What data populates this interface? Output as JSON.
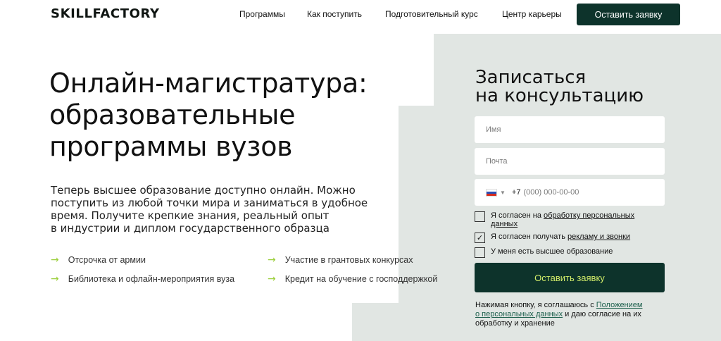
{
  "header": {
    "logo": "SKILLFACTORY",
    "nav": [
      "Программы",
      "Как поступить",
      "Подготовительный курс",
      "Центр карьеры"
    ],
    "cta": "Оставить заявку"
  },
  "hero": {
    "title_lines": [
      "Онлайн‑магистратура:",
      "образовательные",
      "программы вузов"
    ],
    "description_lines": [
      "Теперь высшее образование доступно онлайн. Можно",
      "поступить из любой точки мира и заниматься в удобное",
      "время. Получите крепкие знания, реальный опыт",
      "в индустрии и диплом государственного образца"
    ],
    "features": [
      "Отсрочка от армии",
      "Участие в грантовых конкурсах",
      "Библиотека и офлайн-мероприятия вуза",
      "Кредит на обучение с господдержкой"
    ]
  },
  "form": {
    "title_lines": [
      "Записаться",
      "на консультацию"
    ],
    "name_placeholder": "Имя",
    "email_placeholder": "Почта",
    "phone_code": "+7",
    "phone_placeholder": "(000) 000-00-00",
    "consent_personal": {
      "prefix": "Я согласен на ",
      "link": "обработку персональных",
      "link2": "данных",
      "checked": false
    },
    "consent_ads": {
      "prefix": "Я согласен получать ",
      "link": "рекламу и звонки",
      "checked": true
    },
    "higher_education": {
      "label": "У меня есть высшее образование",
      "checked": false
    },
    "submit": "Оставить заявку",
    "disclaimer": {
      "prefix": "Нажимая кнопку, я соглашаюсь с ",
      "link1": "Положением",
      "link2": "о персональных данных",
      "suffix1": " и даю согласие на их",
      "suffix2": "обработку и хранение"
    }
  },
  "colors": {
    "dark_green": "#0d332b",
    "accent_lime": "#9ccf3c",
    "panel_bg": "#e1e6e3"
  }
}
